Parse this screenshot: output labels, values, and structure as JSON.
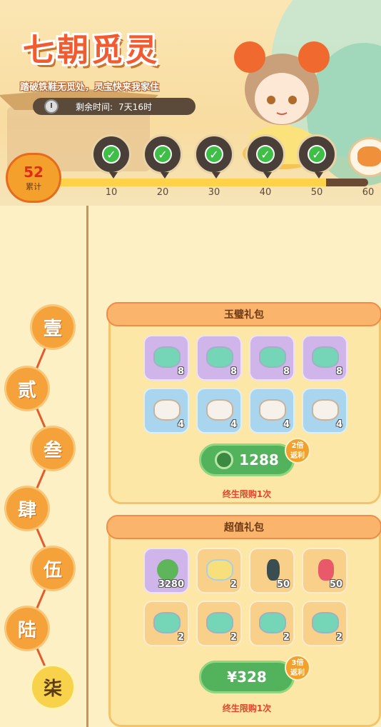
{
  "event": {
    "title": "七朝觅灵",
    "subtitle": "踏破铁鞋无觅处，灵宝快来我家住",
    "timer_label": "剩余时间:",
    "timer_value": "7天16时"
  },
  "progress": {
    "count": "52",
    "count_label": "累计",
    "fill_fraction": 0.87,
    "milestones": [
      {
        "label": "10",
        "claimed": true
      },
      {
        "label": "20",
        "claimed": true
      },
      {
        "label": "30",
        "claimed": true
      },
      {
        "label": "40",
        "claimed": true
      },
      {
        "label": "50",
        "claimed": true
      },
      {
        "label": "60",
        "claimed": false
      }
    ]
  },
  "side_tabs": [
    "壹",
    "贰",
    "叁",
    "肆",
    "伍",
    "陆",
    "柒"
  ],
  "active_tab": 6,
  "packs": [
    {
      "title": "玉璧礼包",
      "items": [
        {
          "icon": "jade-rock-icon",
          "bg": "purple",
          "qty": "8"
        },
        {
          "icon": "jade-rock-icon",
          "bg": "purple",
          "qty": "8"
        },
        {
          "icon": "jade-rock-icon",
          "bg": "purple",
          "qty": "8"
        },
        {
          "icon": "jade-rock-icon",
          "bg": "purple",
          "qty": "8"
        },
        {
          "icon": "shoe-sack-icon",
          "bg": "blue",
          "qty": "4"
        },
        {
          "icon": "shoe-sack-icon",
          "bg": "blue",
          "qty": "4"
        },
        {
          "icon": "shoe-sack-icon",
          "bg": "blue",
          "qty": "4"
        },
        {
          "icon": "shoe-sack-icon",
          "bg": "blue",
          "qty": "4"
        }
      ],
      "price": "1288",
      "price_icon": "jade-coin-icon",
      "badge_line1": "2倍",
      "badge_line2": "返利",
      "limit": "终生限购1次"
    },
    {
      "title": "超值礼包",
      "items": [
        {
          "icon": "jade-coin-icon",
          "bg": "purple",
          "qty": "3280"
        },
        {
          "icon": "rainbow-fan-icon",
          "bg": "orange",
          "qty": "2"
        },
        {
          "icon": "ink-bottle-icon",
          "bg": "orange",
          "qty": "50"
        },
        {
          "icon": "red-bottle-icon",
          "bg": "orange",
          "qty": "50"
        },
        {
          "icon": "jade-rock-icon",
          "bg": "orange",
          "qty": "2"
        },
        {
          "icon": "jade-rock-icon",
          "bg": "orange",
          "qty": "2"
        },
        {
          "icon": "jade-rock-icon",
          "bg": "orange",
          "qty": "2"
        },
        {
          "icon": "jade-rock-icon",
          "bg": "orange",
          "qty": "2"
        }
      ],
      "price": "¥328",
      "badge_line1": "3倍",
      "badge_line2": "返利",
      "limit": "终生限购1次"
    }
  ]
}
